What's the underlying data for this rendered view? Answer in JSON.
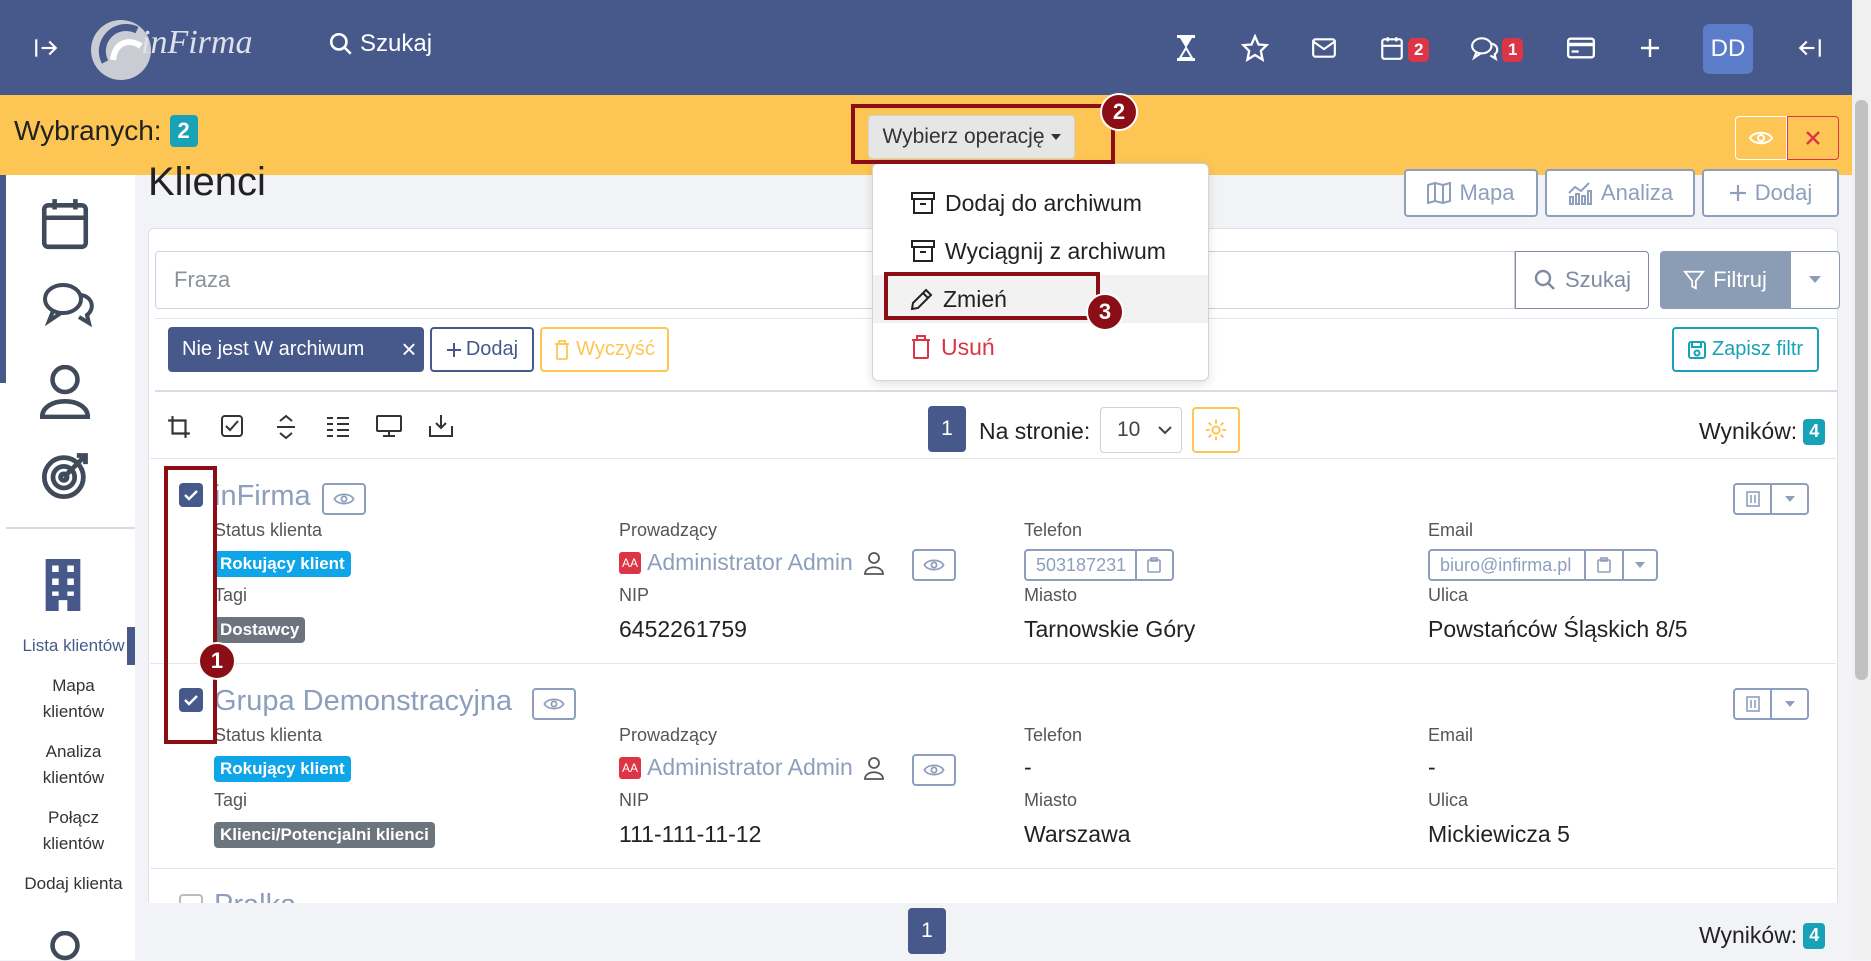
{
  "topbar": {
    "brand": "inFirma",
    "search_label": "Szukaj",
    "calendar_badge": "2",
    "chat_badge": "1",
    "avatar": "DD"
  },
  "selection": {
    "label": "Wybranych:",
    "count": "2",
    "operation_button": "Wybierz operację"
  },
  "callouts": [
    "1",
    "2",
    "3"
  ],
  "menu": {
    "items": [
      {
        "label": "Dodaj do archiwum",
        "icon": "archive-icon"
      },
      {
        "label": "Wyciągnij z archiwum",
        "icon": "archive-icon"
      },
      {
        "label": "Zmień",
        "icon": "pencil-icon"
      },
      {
        "label": "Usuń",
        "icon": "trash-icon"
      }
    ]
  },
  "sidebar": {
    "links": [
      "Lista klientów",
      "Mapa klientów",
      "Analiza klientów",
      "Połącz klientów",
      "Dodaj klienta"
    ]
  },
  "page": {
    "title": "Klienci",
    "btn_map": "Mapa",
    "btn_analysis": "Analiza",
    "btn_add": "Dodaj"
  },
  "search": {
    "placeholder": "Fraza",
    "search_btn": "Szukaj",
    "filter_btn": "Filtruj"
  },
  "filters": {
    "chip": "Nie jest W archiwum",
    "add": "Dodaj",
    "clear": "Wyczyść",
    "save": "Zapisz filtr"
  },
  "paging": {
    "page": "1",
    "per_page_label": "Na stronie:",
    "per_page": "10",
    "results_label": "Wyników:",
    "results": "4"
  },
  "labels": {
    "status": "Status klienta",
    "owner": "Prowadzący",
    "phone": "Telefon",
    "email": "Email",
    "tags": "Tagi",
    "nip": "NIP",
    "city": "Miasto",
    "street": "Ulica"
  },
  "clients": [
    {
      "name": "inFirma",
      "status": "Rokujący klient",
      "owner": "Administrator Admin",
      "owner_initials": "AA",
      "phone": "503187231",
      "email": "biuro@infirma.pl",
      "tag": "Dostawcy",
      "nip": "6452261759",
      "city": "Tarnowskie Góry",
      "street": "Powstańców Śląskich 8/5"
    },
    {
      "name": "Grupa Demonstracyjna",
      "status": "Rokujący klient",
      "owner": "Administrator Admin",
      "owner_initials": "AA",
      "phone": "-",
      "email": "-",
      "tag": "Klienci/Potencjalni klienci",
      "nip": "111-111-11-12",
      "city": "Warszawa",
      "street": "Mickiewicza 5"
    },
    {
      "name": "Pralka"
    }
  ],
  "colors": {
    "navy": "#46598a",
    "yellow": "#fdc654",
    "teal": "#17a2b8",
    "red": "#dc3545",
    "callout": "#8b0d16"
  }
}
